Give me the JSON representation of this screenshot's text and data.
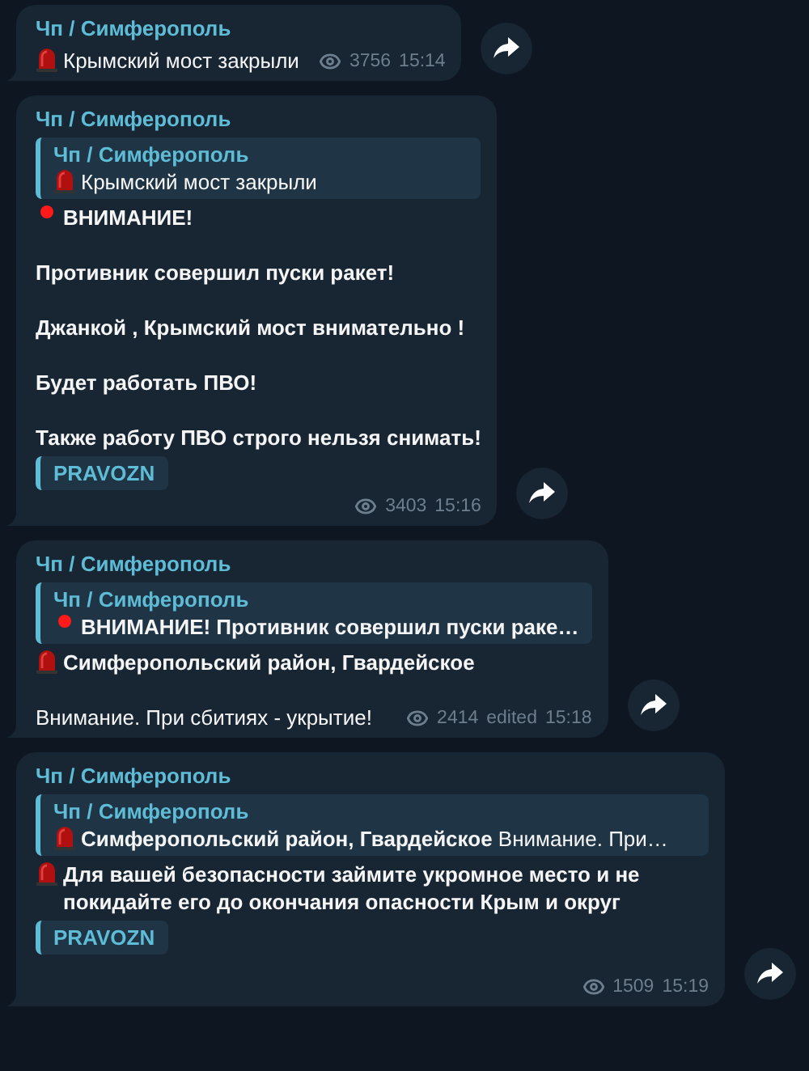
{
  "messages": [
    {
      "author": "Чп / Симферополь",
      "paragraphs": [
        {
          "kind": "siren",
          "text": "Крымский мост закрыли",
          "bold": false
        }
      ],
      "views": "3756",
      "time": "15:14"
    },
    {
      "author": "Чп / Симферополь",
      "reply": {
        "author": "Чп / Симферополь",
        "kind": "siren",
        "text": "Крымский мост закрыли"
      },
      "paragraphs": [
        {
          "kind": "dot",
          "text": "ВНИМАНИЕ!",
          "bold": true
        },
        {
          "text": "Противник совершил пуски ракет!",
          "bold": true
        },
        {
          "text": "Джанкой , Крымский мост внимательно !",
          "bold": true
        },
        {
          "text": "Будет работать ПВО!",
          "bold": true
        },
        {
          "text": "Также работу ПВО строго нельзя снимать!",
          "bold": true
        }
      ],
      "signature": "PRAVOZN",
      "views": "3403",
      "time": "15:16"
    },
    {
      "author": "Чп / Симферополь",
      "reply": {
        "author": "Чп / Симферополь",
        "kind": "dot",
        "text": "**ВНИМАНИЕ!  Противник совершил пуски раке…**"
      },
      "paragraphs": [
        {
          "kind": "siren",
          "text": "Симферопольский район, Гвардейское",
          "bold": true
        },
        {
          "text": "Внимание. При сбитиях - укрытие!",
          "bold": false
        }
      ],
      "views": "2414",
      "edited": "edited",
      "time": "15:18"
    },
    {
      "author": "Чп / Симферополь",
      "reply": {
        "author": "Чп / Симферополь",
        "kind": "siren",
        "text": "**Симферопольский район, Гвардейское**   Внимание. При…"
      },
      "paragraphs": [
        {
          "kind": "siren",
          "text": "Для вашей безопасности займите укромное место и не покидайте его до окончания опасности Крым и округ",
          "bold": true
        }
      ],
      "signature": "PRAVOZN",
      "views": "1509",
      "time": "15:19"
    }
  ]
}
